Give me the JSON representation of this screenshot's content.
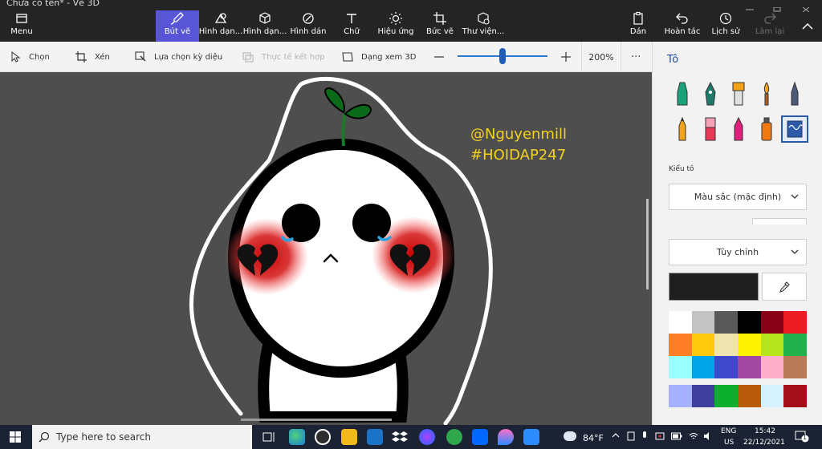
{
  "window": {
    "title": "Chưa có tên* - Vẽ 3D"
  },
  "ribbon": {
    "menu_label": "Menu",
    "tools": [
      {
        "label": "Bút vẽ"
      },
      {
        "label": "Hình dạn..."
      },
      {
        "label": "Hình dạn..."
      },
      {
        "label": "Hình dán"
      },
      {
        "label": "Chữ"
      },
      {
        "label": "Hiệu ứng"
      },
      {
        "label": "Bức vẽ"
      },
      {
        "label": "Thư viện..."
      }
    ],
    "right": [
      {
        "label": "Dán"
      },
      {
        "label": "Hoàn tác"
      },
      {
        "label": "Lịch sử"
      },
      {
        "label": "Làm lại"
      }
    ]
  },
  "toolbar2": {
    "select_label": "Chọn",
    "crop_label": "Xén",
    "magic_select_label": "Lựa chọn kỳ diệu",
    "mixed_reality_label": "Thực tế kết hợp",
    "view3d_label": "Dạng xem 3D",
    "zoom_level": "200%",
    "zoom_fraction": 0.5,
    "more_label": "···"
  },
  "canvas": {
    "watermark_line1": "@Nguyenmill",
    "watermark_line2": "#HOIDAP247"
  },
  "panel": {
    "title": "Tô",
    "brush_style_label": "Kiểu tô",
    "material_value": "Màu sắc (mặc định)",
    "custom_value": "Tùy chỉnh",
    "current_color": "#1f1f1f",
    "palette": [
      "#ffffff",
      "#c3c3c3",
      "#585858",
      "#000000",
      "#880015",
      "#ed1c24",
      "#ff7f27",
      "#ffc90e",
      "#efe4b0",
      "#fff200",
      "#b5e61d",
      "#22b14c",
      "#99ffff",
      "#00a2e8",
      "#3f48cc",
      "#a349a4",
      "#ffaec9",
      "#b97a57",
      "#a6b2ff",
      "#3f3f9f",
      "#0bb02f",
      "#b85c0b",
      "#d5f0ff",
      "#a30f18"
    ]
  },
  "taskbar": {
    "search_placeholder": "Type here to search",
    "weather": "84°F",
    "lang_line1": "ENG",
    "lang_line2": "US",
    "time": "15:42",
    "date": "22/12/2021",
    "notification_count": "1"
  }
}
